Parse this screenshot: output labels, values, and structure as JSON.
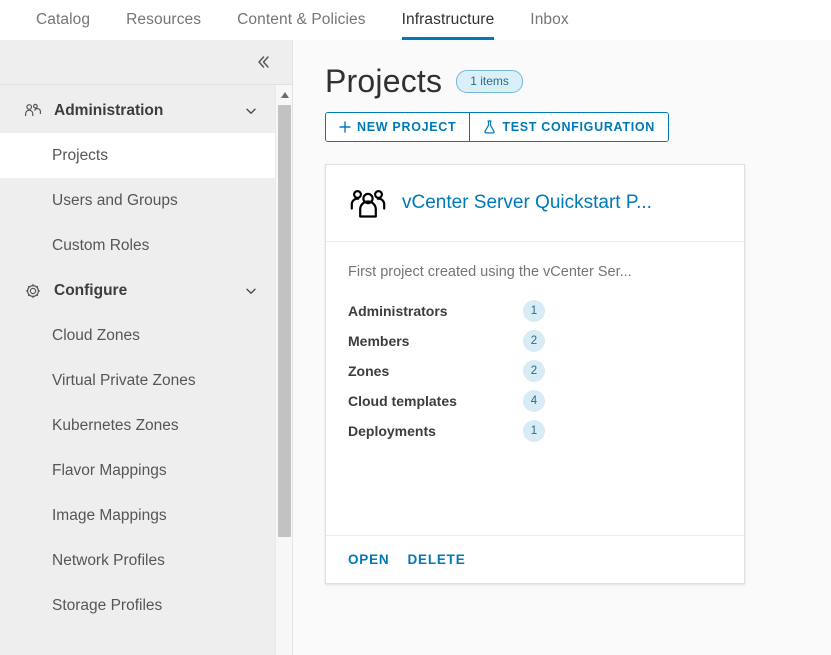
{
  "topnav": {
    "tabs": [
      {
        "label": "Catalog",
        "active": false
      },
      {
        "label": "Resources",
        "active": false
      },
      {
        "label": "Content & Policies",
        "active": false
      },
      {
        "label": "Infrastructure",
        "active": true
      },
      {
        "label": "Inbox",
        "active": false
      }
    ]
  },
  "sidebar": {
    "collapse_icon": "chevron-double-left-icon",
    "groups": [
      {
        "label": "Administration",
        "icon": "users-group-icon",
        "chevron": "chevron-down-icon",
        "items": [
          {
            "label": "Projects",
            "selected": true
          },
          {
            "label": "Users and Groups",
            "selected": false
          },
          {
            "label": "Custom Roles",
            "selected": false
          }
        ]
      },
      {
        "label": "Configure",
        "icon": "gear-icon",
        "chevron": "chevron-down-icon",
        "items": [
          {
            "label": "Cloud Zones",
            "selected": false
          },
          {
            "label": "Virtual Private Zones",
            "selected": false
          },
          {
            "label": "Kubernetes Zones",
            "selected": false
          },
          {
            "label": "Flavor Mappings",
            "selected": false
          },
          {
            "label": "Image Mappings",
            "selected": false
          },
          {
            "label": "Network Profiles",
            "selected": false
          },
          {
            "label": "Storage Profiles",
            "selected": false
          }
        ]
      }
    ]
  },
  "main": {
    "title": "Projects",
    "items_badge": "1 items",
    "buttons": [
      {
        "label": "NEW PROJECT",
        "icon": "plus-icon"
      },
      {
        "label": "TEST CONFIGURATION",
        "icon": "flask-icon"
      }
    ],
    "card": {
      "icon": "users-group-icon",
      "title": "vCenter Server Quickstart P...",
      "description": "First project created using the vCenter Ser...",
      "stats": [
        {
          "label": "Administrators",
          "value": "1"
        },
        {
          "label": "Members",
          "value": "2"
        },
        {
          "label": "Zones",
          "value": "2"
        },
        {
          "label": "Cloud templates",
          "value": "4"
        },
        {
          "label": "Deployments",
          "value": "1"
        }
      ],
      "actions": [
        {
          "label": "OPEN"
        },
        {
          "label": "DELETE"
        }
      ]
    }
  },
  "colors": {
    "accent": "#0079b8",
    "sidebar_bg": "#eeeeee",
    "page_bg": "#fafafa",
    "badge_bg": "#d9f0f8",
    "text": "#565656"
  }
}
